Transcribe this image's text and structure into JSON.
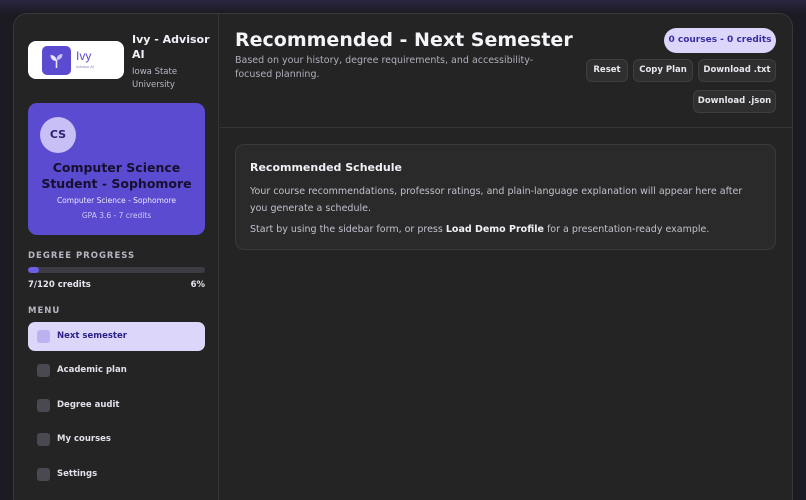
{
  "app": {
    "logo_text": "Ivy",
    "logo_subtext": "Advisor AI",
    "name": "Ivy - Advisor AI",
    "school": "Iowa State University"
  },
  "profile": {
    "initials": "CS",
    "name": "Computer Science Student - Sophomore",
    "major": "Computer Science - Sophomore",
    "gpa_credits": "GPA 3.6 - 7 credits"
  },
  "progress": {
    "label": "DEGREE PROGRESS",
    "credits": "7/120 credits",
    "percent_text": "6%",
    "fraction": 0.06
  },
  "menu": {
    "label": "MENU",
    "items": [
      {
        "label": "Next semester",
        "active": true
      },
      {
        "label": "Academic plan",
        "active": false
      },
      {
        "label": "Degree audit",
        "active": false
      },
      {
        "label": "My courses",
        "active": false
      },
      {
        "label": "Settings",
        "active": false
      }
    ]
  },
  "header": {
    "title": "Recommended - Next Semester",
    "subtitle": "Based on your history, degree requirements, and accessibility-focused planning.",
    "summary_pill": "0 courses - 0 credits",
    "buttons": {
      "reset": "Reset",
      "copy": "Copy Plan",
      "download_txt": "Download .txt",
      "download_json": "Download .json"
    }
  },
  "schedule": {
    "title": "Recommended Schedule",
    "p1": "Your course recommendations, professor ratings, and plain-language explanation will appear here after you generate a schedule.",
    "p2_before": "Start by using the sidebar form, or press ",
    "p2_bold": "Load Demo Profile",
    "p2_after": " for a presentation-ready example."
  },
  "colors": {
    "accent": "#5b4bd0",
    "accent_light": "#dcd6fb",
    "background": "#242424"
  }
}
